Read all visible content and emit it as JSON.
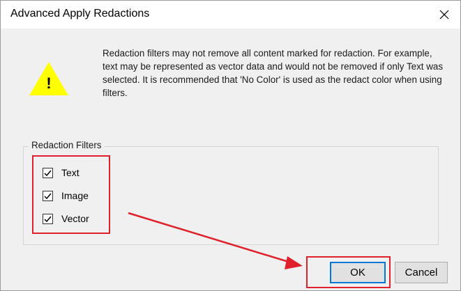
{
  "dialog": {
    "title": "Advanced Apply Redactions",
    "close_icon": "close-icon",
    "warning_icon": "warning-icon",
    "warning_glyph": "!",
    "message": "Redaction filters may not remove all content marked for redaction. For example, text may be represented as vector data and would not be removed if only Text was selected. It is recommended that 'No Color' is used as the redact color when using filters.",
    "filters_group": {
      "label": "Redaction Filters",
      "options": [
        {
          "label": "Text",
          "checked": true
        },
        {
          "label": "Image",
          "checked": true
        },
        {
          "label": "Vector",
          "checked": true
        }
      ]
    },
    "buttons": {
      "ok_label": "OK",
      "cancel_label": "Cancel"
    }
  },
  "colors": {
    "annotation": "#e0202a",
    "warning": "#ffff00",
    "focus": "#0078d7"
  }
}
